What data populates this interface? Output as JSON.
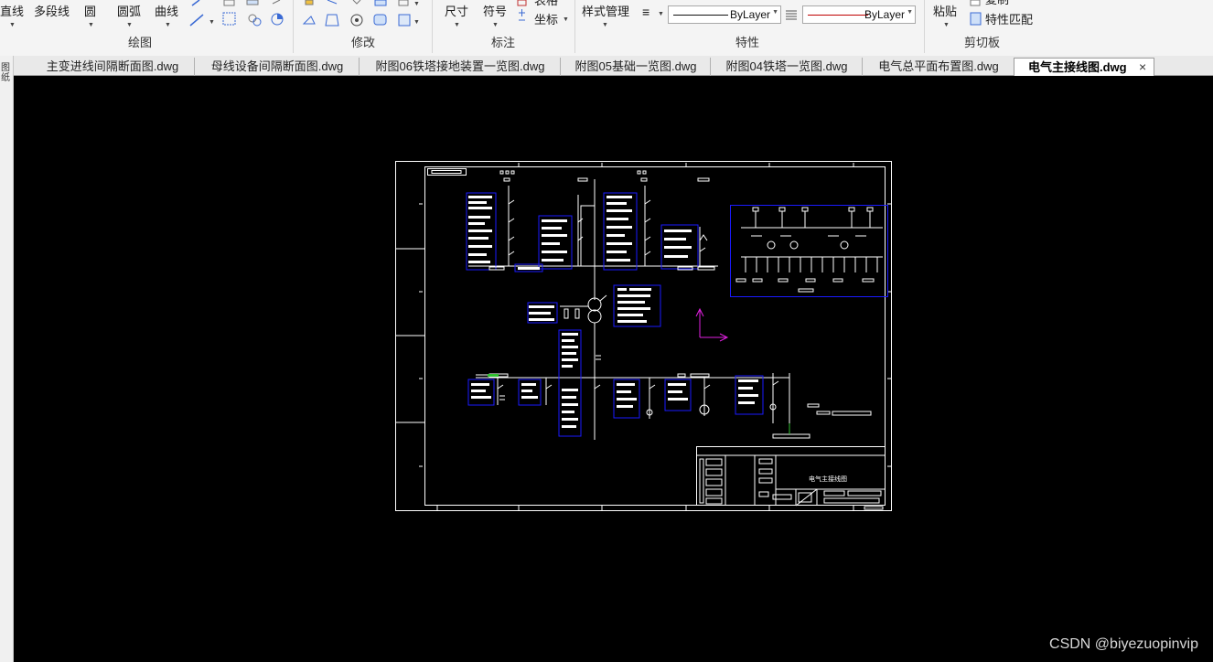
{
  "ribbon": {
    "draw_group": {
      "label": "绘图",
      "line": "直线",
      "polyline": "多段线",
      "circle": "圆",
      "arc": "圆弧",
      "curve": "曲线"
    },
    "modify_group": {
      "label": "修改"
    },
    "annotate_group": {
      "label": "标注",
      "dimension": "尺寸",
      "symbol": "符号",
      "table": "表格",
      "coordinate": "坐标"
    },
    "properties_group": {
      "label": "特性",
      "style_manager": "样式管理",
      "linetype_value": "ByLayer",
      "color_value": "ByLayer",
      "color_hex": "#c00000"
    },
    "clipboard_group": {
      "label": "剪切板",
      "paste": "粘贴",
      "copy": "复制",
      "match_properties": "特性匹配"
    }
  },
  "tabs": [
    {
      "label": "主变进线间隔断面图.dwg",
      "active": false
    },
    {
      "label": "母线设备间隔断面图.dwg",
      "active": false
    },
    {
      "label": "附图06铁塔接地装置一览图.dwg",
      "active": false
    },
    {
      "label": "附图05基础一览图.dwg",
      "active": false
    },
    {
      "label": "附图04铁塔一览图.dwg",
      "active": false
    },
    {
      "label": "电气总平面布置图.dwg",
      "active": false
    },
    {
      "label": "电气主接线图.dwg",
      "active": true
    }
  ],
  "tab_close": "×",
  "left_panel_label": "图纸",
  "drawing": {
    "title_block_name": "电气主接线图"
  },
  "watermark": "CSDN @biyezuopinvip",
  "colors": {
    "canvas_bg": "#000000",
    "ucs_icon": "#e020e0",
    "blue_selection": "#1a1aff"
  }
}
